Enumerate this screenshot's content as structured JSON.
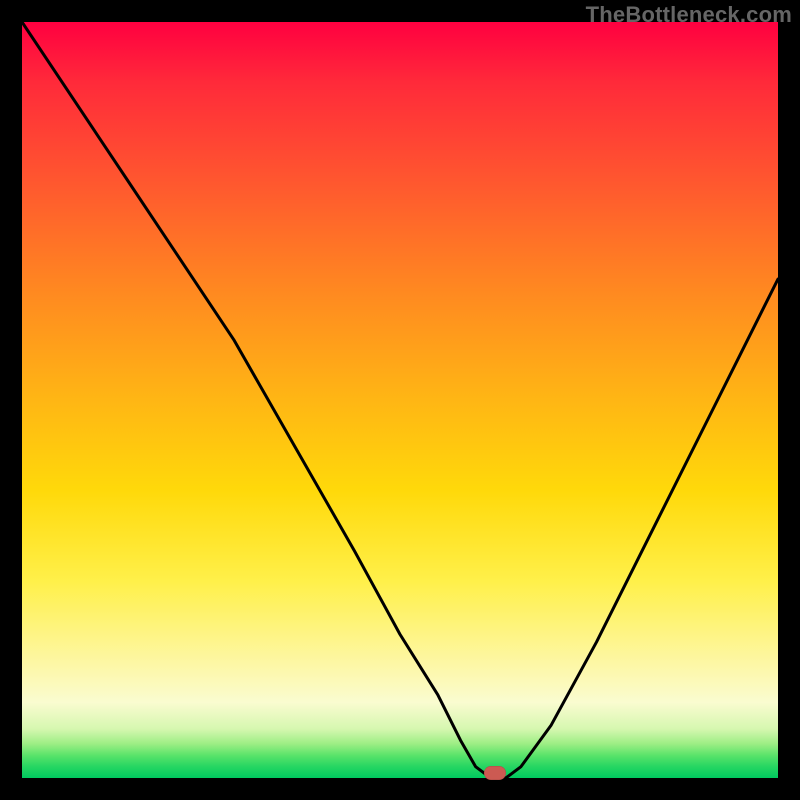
{
  "attribution": "TheBottleneck.com",
  "chart_data": {
    "type": "line",
    "title": "",
    "xlabel": "",
    "ylabel": "",
    "xlim": [
      0,
      100
    ],
    "ylim": [
      0,
      100
    ],
    "x": [
      0,
      10,
      20,
      28,
      36,
      44,
      50,
      55,
      58,
      60,
      62,
      64,
      66,
      70,
      76,
      84,
      92,
      100
    ],
    "values": [
      100,
      85,
      70,
      58,
      44,
      30,
      19,
      11,
      5,
      1.5,
      0,
      0,
      1.5,
      7,
      18,
      34,
      50,
      66
    ],
    "marker": {
      "x": 62.5,
      "y": 0.7
    },
    "series_name": "bottleneck-curve"
  },
  "colors": {
    "background": "#000000",
    "curve": "#000000",
    "marker": "#cc5a52",
    "attribution": "#666666"
  }
}
